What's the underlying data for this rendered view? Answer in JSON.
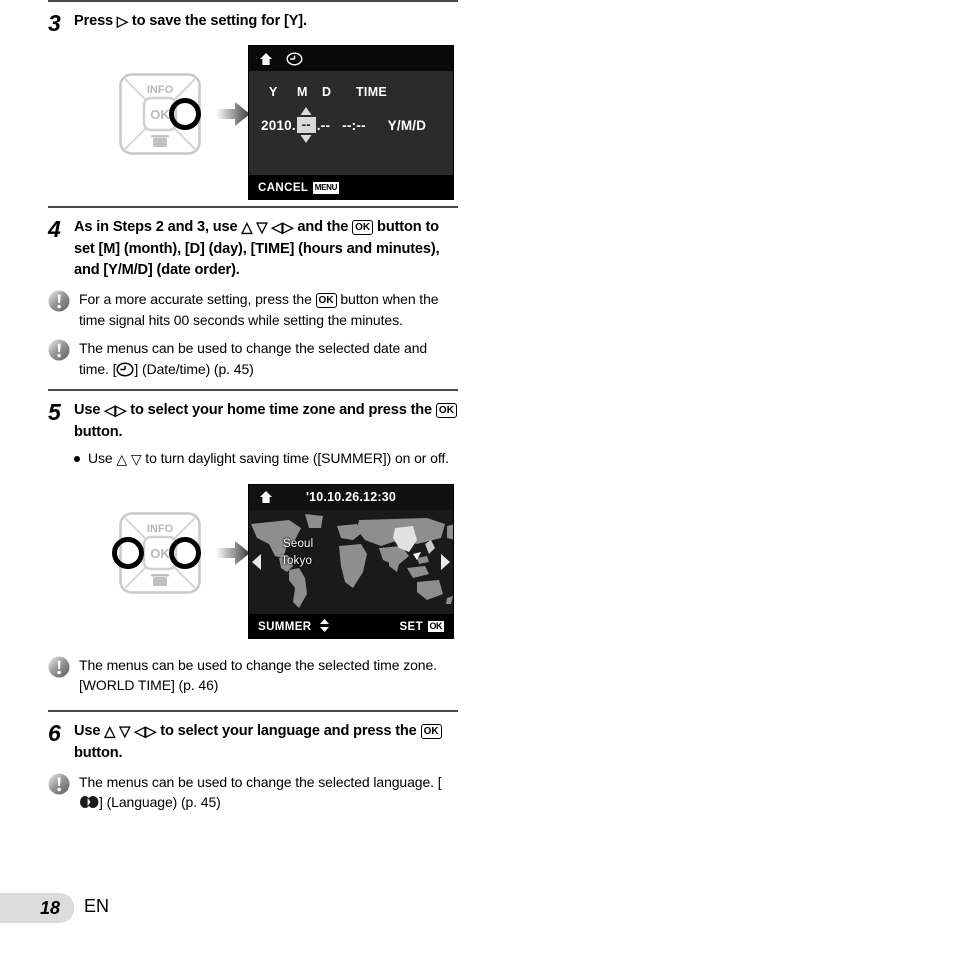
{
  "page": {
    "number": "18",
    "language_code": "EN"
  },
  "steps": [
    {
      "id": "step-3",
      "number": "3",
      "text_parts": {
        "a": "Press ",
        "arrow": "▷",
        "b": " to save the setting for [Y]."
      }
    },
    {
      "id": "step-4",
      "number": "4",
      "text_parts": {
        "a": "As in Steps 2 and 3, use ",
        "arrows": "△ ▽ ◁▷",
        "b": " and the ",
        "ok": "OK",
        "c": " button to set [M] (month), [D] (day), [TIME] (hours and minutes), and [Y/M/D] (date order)."
      }
    },
    {
      "id": "step-5",
      "number": "5",
      "text_parts": {
        "a": "Use ",
        "arrows": "◁▷",
        "b": " to select your home time zone and press the ",
        "ok": "OK",
        "c": " button."
      }
    },
    {
      "id": "step-6",
      "number": "6",
      "text_parts": {
        "a": "Use ",
        "arrows": "△ ▽ ◁▷",
        "b": " to select your language and press the ",
        "ok": "OK",
        "c": " button."
      }
    }
  ],
  "notes": {
    "accurate_setting": {
      "a": "For a more accurate setting, press the ",
      "ok": "OK",
      "b": " button when the time signal hits 00 seconds while setting the minutes."
    },
    "date_time_menu": {
      "a": "The menus can be used to change the selected date and time. [",
      "icon": "clock-icon",
      "b": "] (Date/time) (p. 45)"
    },
    "world_time_menu": {
      "a": "The menus can be used to change the selected time zone. [WORLD TIME] (p. 46)"
    },
    "language_menu": {
      "a": "The menus can be used to change the selected language. [",
      "icon": "language-icon",
      "b": "] (Language) (p. 45)"
    }
  },
  "bullets": {
    "summer_time": {
      "a": "Use ",
      "arrows": "△ ▽",
      "b": " to turn daylight saving time ([SUMMER]) on or off."
    }
  },
  "dpad": {
    "info_label": "INFO",
    "ok_label": "OK",
    "trash_label": "trash-icon"
  },
  "date_screen": {
    "columns": [
      "Y",
      "M",
      "D",
      "TIME"
    ],
    "year": "2010",
    "month": "--",
    "day": "--",
    "hour": "--",
    "minute": "--",
    "order": "Y/M/D",
    "separator_dot": ".",
    "time_colon": ":",
    "cancel_label": "CANCEL",
    "cancel_badge": "MENU"
  },
  "map_screen": {
    "datetime": "'10.10.26.12:30",
    "cities": [
      "Seoul",
      "Tokyo"
    ],
    "summer_label": "SUMMER",
    "set_label": "SET",
    "set_badge": "OK"
  },
  "colors": {
    "rule": "#4a4a4a",
    "page_box": "#dcdcdc",
    "lcd_bg": "#000000",
    "lcd_body": "#2b2b2b",
    "map_land": "#8c8c8c",
    "map_sea": "#1a1a1a",
    "highlight": "#d9d9d9"
  }
}
